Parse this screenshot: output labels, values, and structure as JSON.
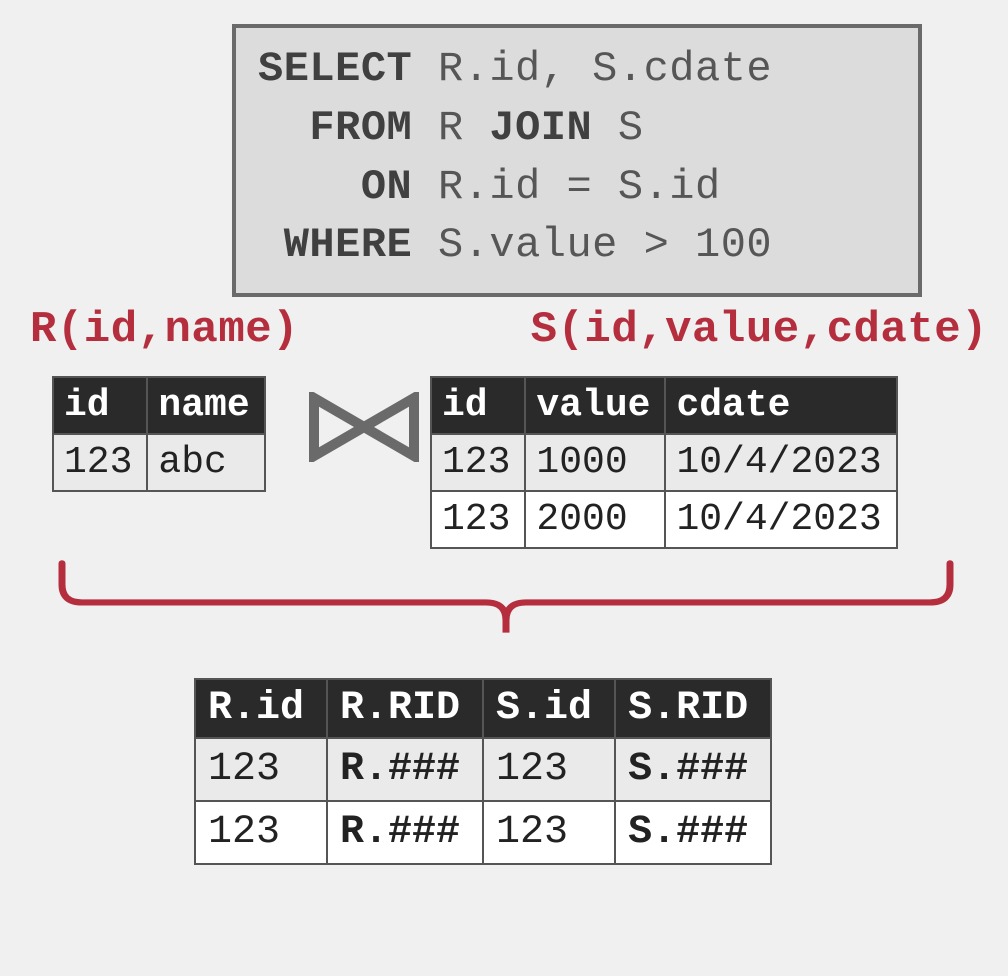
{
  "sql": {
    "line1_kw": "SELECT",
    "line1_rest": " R.id, S.cdate",
    "line2_kw1": "FROM",
    "line2_mid": " R ",
    "line2_kw2": "JOIN",
    "line2_rest": " S",
    "line3_kw": "ON",
    "line3_rest": " R.id = S.id",
    "line4_kw": "WHERE",
    "line4_rest": " S.value > 100"
  },
  "schemas": {
    "R": "R(id,name)",
    "S": "S(id,value,cdate)"
  },
  "tableR": {
    "headers": {
      "id": "id",
      "name": "name"
    },
    "rows": [
      {
        "id": "123",
        "name": "abc"
      }
    ]
  },
  "tableS": {
    "headers": {
      "id": "id",
      "value": "value",
      "cdate": "cdate"
    },
    "rows": [
      {
        "id": "123",
        "value": "1000",
        "cdate": "10/4/2023"
      },
      {
        "id": "123",
        "value": "2000",
        "cdate": "10/4/2023"
      }
    ]
  },
  "result": {
    "headers": {
      "rid": "R.id",
      "rrid": "R.RID",
      "sid": "S.id",
      "srid": "S.RID"
    },
    "rows": [
      {
        "rid": "123",
        "rrid": "R.###",
        "sid": "123",
        "srid": "S.###"
      },
      {
        "rid": "123",
        "rrid": "R.###",
        "sid": "123",
        "srid": "S.###"
      }
    ]
  }
}
